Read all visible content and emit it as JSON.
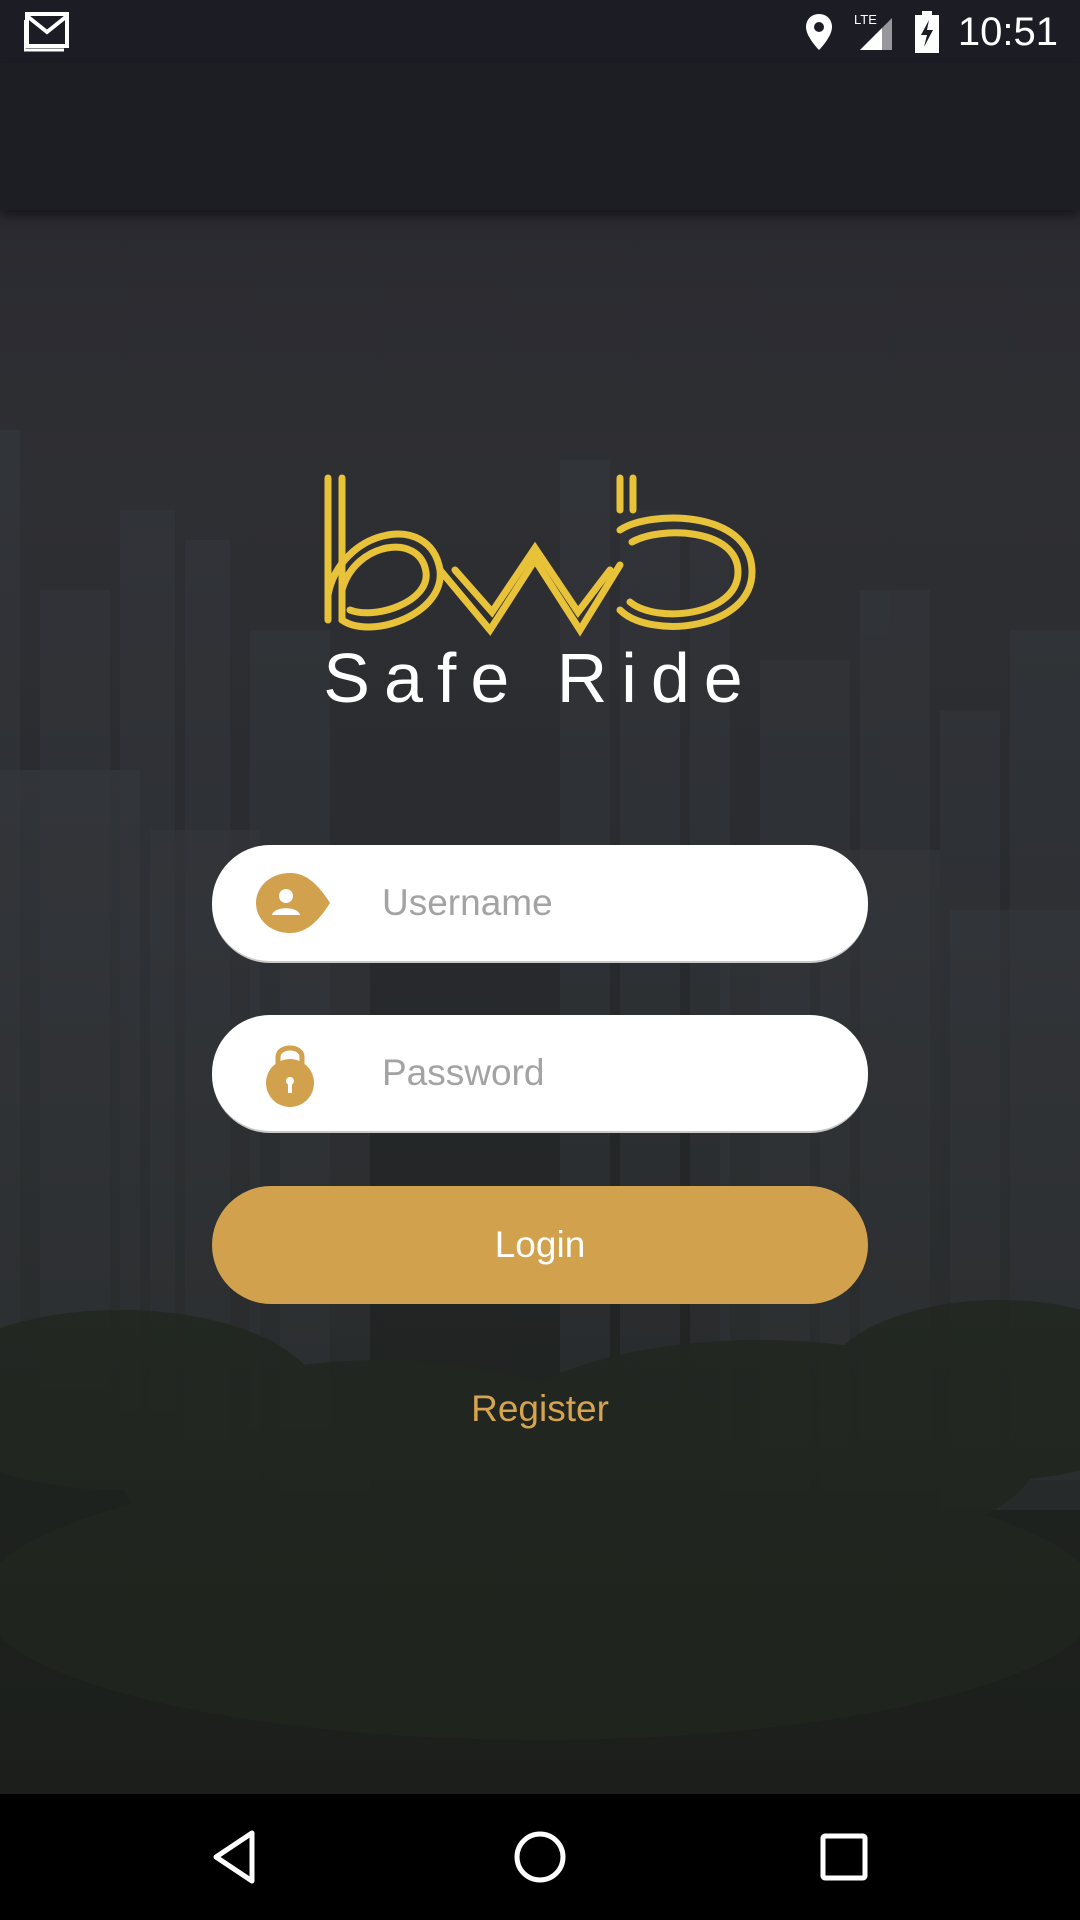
{
  "status_bar": {
    "time": "10:51",
    "network": "LTE",
    "icons": [
      "gmail-icon",
      "location-icon",
      "signal-icon",
      "battery-charging-icon"
    ]
  },
  "logo": {
    "brand_text": "Safe Ride",
    "mark": "bwb"
  },
  "form": {
    "username_placeholder": "Username",
    "password_placeholder": "Password",
    "login_label": "Login",
    "register_label": "Register"
  },
  "nav_bar": {
    "icons": [
      "back-icon",
      "home-icon",
      "recents-icon"
    ]
  },
  "colors": {
    "accent": "#d1a14d",
    "link": "#d6a450",
    "logo_gold": "#e8c239",
    "field_bg": "#ffffff",
    "placeholder": "#a3a3a3",
    "app_bar": "#1d1d24"
  }
}
